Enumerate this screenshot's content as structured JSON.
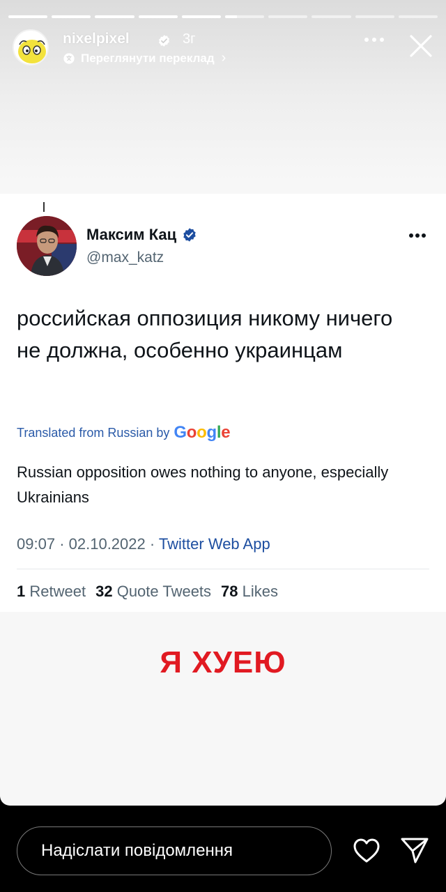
{
  "story": {
    "username": "nixelpixel",
    "age": "3г",
    "translate_label": "Переглянути переклад",
    "translate_chevron": "›",
    "progress": [
      1,
      1,
      1,
      1,
      1,
      0.3,
      0,
      0,
      0,
      0
    ],
    "caption": "Я ХУЕЮ"
  },
  "tweet": {
    "author_name": "Максим Кац",
    "handle": "@max_katz",
    "text": "российская оппозиция никому ничего не должна, особенно украинцам",
    "translated_label": "Translated from Russian by",
    "google_letters": [
      {
        "ch": "G",
        "color": "#4285f4"
      },
      {
        "ch": "o",
        "color": "#ea4335"
      },
      {
        "ch": "o",
        "color": "#fbbc05"
      },
      {
        "ch": "g",
        "color": "#4285f4"
      },
      {
        "ch": "l",
        "color": "#34a853"
      },
      {
        "ch": "e",
        "color": "#ea4335"
      }
    ],
    "translation": "Russian opposition owes nothing to anyone, especially Ukrainians",
    "time": "09:07",
    "date": "02.10.2022",
    "source": "Twitter Web App",
    "separator": "·",
    "stats": {
      "retweets_count": "1",
      "retweets_label": "Retweet",
      "quotes_count": "32",
      "quotes_label": "Quote Tweets",
      "likes_count": "78",
      "likes_label": "Likes"
    }
  },
  "reply": {
    "placeholder": "Надіслати повідомлення"
  },
  "colors": {
    "verified_blue": "#1d9bf0",
    "caption_red": "#e11a22",
    "link_blue": "#2a5aa8"
  },
  "icons": [
    "verified-badge-icon",
    "translate-icon",
    "more-icon",
    "close-icon",
    "heart-icon",
    "send-icon"
  ]
}
